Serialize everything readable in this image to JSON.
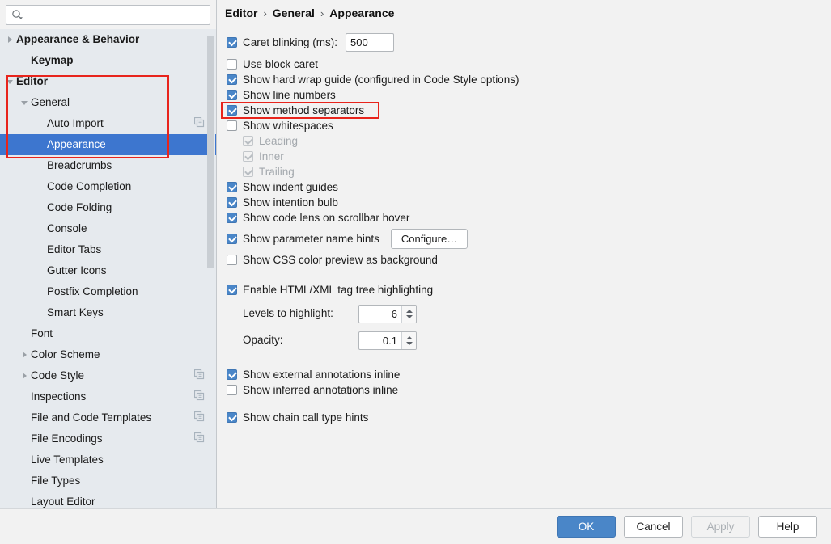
{
  "search": {
    "placeholder": "",
    "value": "",
    "icon": "search-icon"
  },
  "sidebar": {
    "items": [
      {
        "label": "Appearance & Behavior",
        "indent": 0,
        "arrow": "right",
        "bold": true,
        "selected": false,
        "copy": false
      },
      {
        "label": "Keymap",
        "indent": 1,
        "arrow": "none",
        "bold": true,
        "selected": false,
        "copy": false
      },
      {
        "label": "Editor",
        "indent": 0,
        "arrow": "down",
        "bold": true,
        "selected": false,
        "copy": false
      },
      {
        "label": "General",
        "indent": 1,
        "arrow": "down",
        "bold": false,
        "selected": false,
        "copy": false
      },
      {
        "label": "Auto Import",
        "indent": 2,
        "arrow": "none",
        "bold": false,
        "selected": false,
        "copy": true
      },
      {
        "label": "Appearance",
        "indent": 2,
        "arrow": "none",
        "bold": false,
        "selected": true,
        "copy": false
      },
      {
        "label": "Breadcrumbs",
        "indent": 2,
        "arrow": "none",
        "bold": false,
        "selected": false,
        "copy": false
      },
      {
        "label": "Code Completion",
        "indent": 2,
        "arrow": "none",
        "bold": false,
        "selected": false,
        "copy": false
      },
      {
        "label": "Code Folding",
        "indent": 2,
        "arrow": "none",
        "bold": false,
        "selected": false,
        "copy": false
      },
      {
        "label": "Console",
        "indent": 2,
        "arrow": "none",
        "bold": false,
        "selected": false,
        "copy": false
      },
      {
        "label": "Editor Tabs",
        "indent": 2,
        "arrow": "none",
        "bold": false,
        "selected": false,
        "copy": false
      },
      {
        "label": "Gutter Icons",
        "indent": 2,
        "arrow": "none",
        "bold": false,
        "selected": false,
        "copy": false
      },
      {
        "label": "Postfix Completion",
        "indent": 2,
        "arrow": "none",
        "bold": false,
        "selected": false,
        "copy": false
      },
      {
        "label": "Smart Keys",
        "indent": 2,
        "arrow": "none",
        "bold": false,
        "selected": false,
        "copy": false
      },
      {
        "label": "Font",
        "indent": 1,
        "arrow": "none",
        "bold": false,
        "selected": false,
        "copy": false
      },
      {
        "label": "Color Scheme",
        "indent": 1,
        "arrow": "right",
        "bold": false,
        "selected": false,
        "copy": false
      },
      {
        "label": "Code Style",
        "indent": 1,
        "arrow": "right",
        "bold": false,
        "selected": false,
        "copy": true
      },
      {
        "label": "Inspections",
        "indent": 1,
        "arrow": "none",
        "bold": false,
        "selected": false,
        "copy": true
      },
      {
        "label": "File and Code Templates",
        "indent": 1,
        "arrow": "none",
        "bold": false,
        "selected": false,
        "copy": true
      },
      {
        "label": "File Encodings",
        "indent": 1,
        "arrow": "none",
        "bold": false,
        "selected": false,
        "copy": true
      },
      {
        "label": "Live Templates",
        "indent": 1,
        "arrow": "none",
        "bold": false,
        "selected": false,
        "copy": false
      },
      {
        "label": "File Types",
        "indent": 1,
        "arrow": "none",
        "bold": false,
        "selected": false,
        "copy": false
      },
      {
        "label": "Layout Editor",
        "indent": 1,
        "arrow": "none",
        "bold": false,
        "selected": false,
        "copy": false
      }
    ]
  },
  "breadcrumb": {
    "parts": [
      "Editor",
      "General",
      "Appearance"
    ],
    "separator": "›"
  },
  "options": {
    "caret_blinking": {
      "label": "Caret blinking (ms):",
      "checked": true,
      "value": "500"
    },
    "use_block_caret": {
      "label": "Use block caret",
      "checked": false
    },
    "show_hard_wrap_guide": {
      "label": "Show hard wrap guide (configured in Code Style options)",
      "checked": true
    },
    "show_line_numbers": {
      "label": "Show line numbers",
      "checked": true
    },
    "show_method_separators": {
      "label": "Show method separators",
      "checked": true,
      "highlighted": true
    },
    "show_whitespaces": {
      "label": "Show whitespaces",
      "checked": false
    },
    "whitespace_leading": {
      "label": "Leading",
      "checked": true,
      "disabled": true
    },
    "whitespace_inner": {
      "label": "Inner",
      "checked": true,
      "disabled": true
    },
    "whitespace_trailing": {
      "label": "Trailing",
      "checked": true,
      "disabled": true
    },
    "show_indent_guides": {
      "label": "Show indent guides",
      "checked": true
    },
    "show_intention_bulb": {
      "label": "Show intention bulb",
      "checked": true
    },
    "show_code_lens": {
      "label": "Show code lens on scrollbar hover",
      "checked": true
    },
    "show_parameter_name_hints": {
      "label": "Show parameter name hints",
      "checked": true,
      "button": "Configure…"
    },
    "show_css_color_preview": {
      "label": "Show CSS color preview as background",
      "checked": false
    },
    "enable_tag_tree_highlighting": {
      "label": "Enable HTML/XML tag tree highlighting",
      "checked": true
    },
    "levels_to_highlight": {
      "label": "Levels to highlight:",
      "value": "6"
    },
    "opacity": {
      "label": "Opacity:",
      "value": "0.1"
    },
    "show_external_annotations": {
      "label": "Show external annotations inline",
      "checked": true
    },
    "show_inferred_annotations": {
      "label": "Show inferred annotations inline",
      "checked": false
    },
    "show_chain_call_type_hints": {
      "label": "Show chain call type hints",
      "checked": true
    }
  },
  "buttons": {
    "ok": "OK",
    "cancel": "Cancel",
    "apply": "Apply",
    "help": "Help"
  },
  "colors": {
    "accent": "#4a86c8",
    "selection": "#3d76cf",
    "sidebar_bg": "#e6eaee",
    "panel_bg": "#f2f2f2",
    "annotation": "#e8241c"
  }
}
